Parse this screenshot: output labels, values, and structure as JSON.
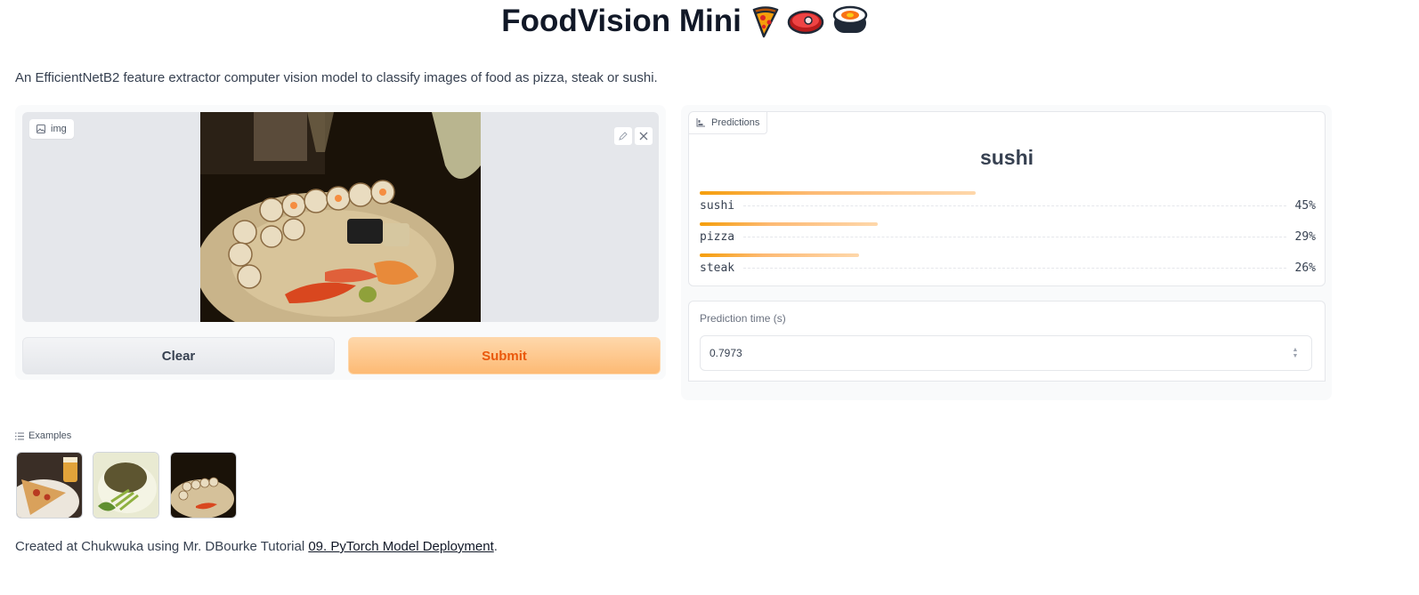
{
  "header": {
    "title": "FoodVision Mini",
    "emojis": [
      "🍕",
      "🥩",
      "🍣"
    ],
    "description": "An EfficientNetB2 feature extractor computer vision model to classify images of food as pizza, steak or sushi."
  },
  "input": {
    "label": "img",
    "clear_label": "Clear",
    "submit_label": "Submit"
  },
  "predictions": {
    "label": "Predictions",
    "top_label": "sushi",
    "items": [
      {
        "label": "sushi",
        "percent": "45%",
        "value": 0.45
      },
      {
        "label": "pizza",
        "percent": "29%",
        "value": 0.29
      },
      {
        "label": "steak",
        "percent": "26%",
        "value": 0.26
      }
    ]
  },
  "prediction_time": {
    "label": "Prediction time (s)",
    "value": "0.7973"
  },
  "examples": {
    "label": "Examples",
    "items": [
      "pizza-example",
      "steak-example",
      "sushi-example"
    ]
  },
  "footer": {
    "prefix": "Created at Chukwuka using Mr. DBourke Tutorial",
    "link_text": "09. PyTorch Model Deployment",
    "suffix": "."
  },
  "colors": {
    "accent": "#f97316",
    "submit_bg": "#fdba74",
    "panel_bg": "#f9fafb"
  }
}
